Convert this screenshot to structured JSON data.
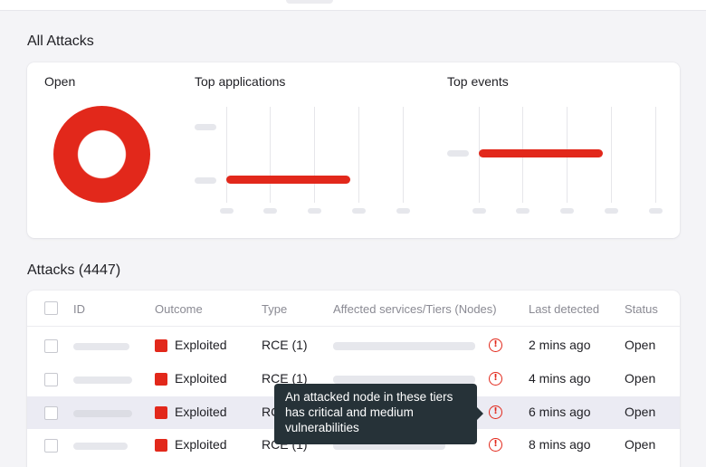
{
  "overview": {
    "title": "All Attacks",
    "panels": {
      "open": {
        "title": "Open"
      },
      "top_applications": {
        "title": "Top applications"
      },
      "top_events": {
        "title": "Top events"
      }
    }
  },
  "attacks": {
    "title": "Attacks (4447)",
    "columns": {
      "id": "ID",
      "outcome": "Outcome",
      "type": "Type",
      "affected": "Affected services/Tiers (Nodes)",
      "last_detected": "Last detected",
      "status": "Status"
    },
    "rows": [
      {
        "outcome": "Exploited",
        "type": "RCE (1)",
        "last_detected": "2 mins ago",
        "status": "Open"
      },
      {
        "outcome": "Exploited",
        "type": "RCE (1)",
        "last_detected": "4 mins ago",
        "status": "Open"
      },
      {
        "outcome": "Exploited",
        "type": "RCE (1)",
        "last_detected": "6 mins ago",
        "status": "Open"
      },
      {
        "outcome": "Exploited",
        "type": "RCE (1)",
        "last_detected": "8 mins ago",
        "status": "Open"
      }
    ]
  },
  "tooltip": {
    "line1": "An attacked node in these tiers",
    "line2": "has critical and medium",
    "line3": "vulnerabilities"
  },
  "alert_glyph": "!",
  "colors": {
    "accent": "#e2281b",
    "tooltip_bg": "#263238"
  }
}
